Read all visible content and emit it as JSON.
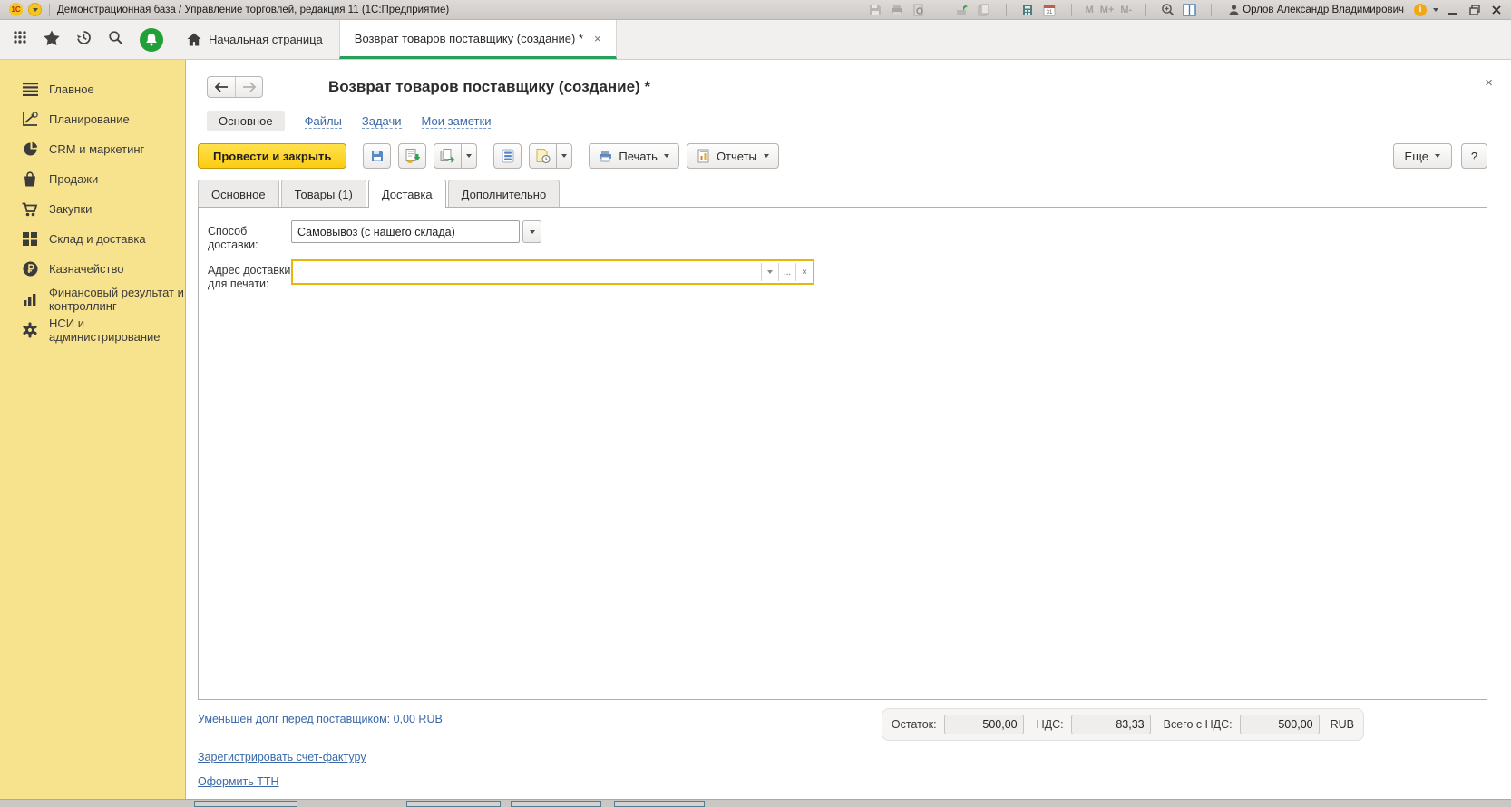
{
  "titlebar": {
    "logo": "1С",
    "title": "Демонстрационная база / Управление торговлей, редакция 11  (1С:Предприятие)",
    "user": "Орлов Александр Владимирович",
    "info_glyph": "i",
    "mem": {
      "m": "M",
      "m_plus": "M+",
      "m_minus": "M-"
    }
  },
  "tabbar": {
    "home_tab": "Начальная страница",
    "active_tab": "Возврат товаров поставщику (создание) *",
    "close_glyph": "×"
  },
  "sidebar": {
    "items": [
      {
        "label": "Главное"
      },
      {
        "label": "Планирование"
      },
      {
        "label": "CRM и маркетинг"
      },
      {
        "label": "Продажи"
      },
      {
        "label": "Закупки"
      },
      {
        "label": "Склад и доставка"
      },
      {
        "label": "Казначейство"
      },
      {
        "label": "Финансовый результат и контроллинг"
      },
      {
        "label": "НСИ и администрирование"
      }
    ]
  },
  "header": {
    "title": "Возврат товаров поставщику (создание) *",
    "close_glyph": "×",
    "nav_active": "Основное",
    "links": [
      {
        "label": "Файлы"
      },
      {
        "label": "Задачи"
      },
      {
        "label": "Мои заметки"
      }
    ]
  },
  "toolbar": {
    "post_close": "Провести и закрыть",
    "print": "Печать",
    "reports": "Отчеты",
    "more": "Еще",
    "help": "?"
  },
  "form": {
    "tabs": [
      {
        "label": "Основное"
      },
      {
        "label": "Товары (1)"
      },
      {
        "label": "Доставка"
      },
      {
        "label": "Дополнительно"
      }
    ],
    "delivery_method_label": "Способ доставки:",
    "delivery_method_value": "Самовывоз (с нашего склада)",
    "address_label_line1": "Адрес доставки",
    "address_label_line2": "для печати:",
    "address_value": "",
    "address_buttons": {
      "ellipsis": "...",
      "clear": "×"
    }
  },
  "footer": {
    "debt_link": "Уменьшен долг перед поставщиком: 0,00 RUB",
    "invoice_link": "Зарегистрировать счет-фактуру",
    "ttn_link": "Оформить ТТН",
    "totals": [
      {
        "label": "Остаток:",
        "value": "500,00"
      },
      {
        "label": "НДС:",
        "value": "83,33"
      },
      {
        "label": "Всего с НДС:",
        "value": "500,00"
      }
    ],
    "currency": "RUB"
  }
}
